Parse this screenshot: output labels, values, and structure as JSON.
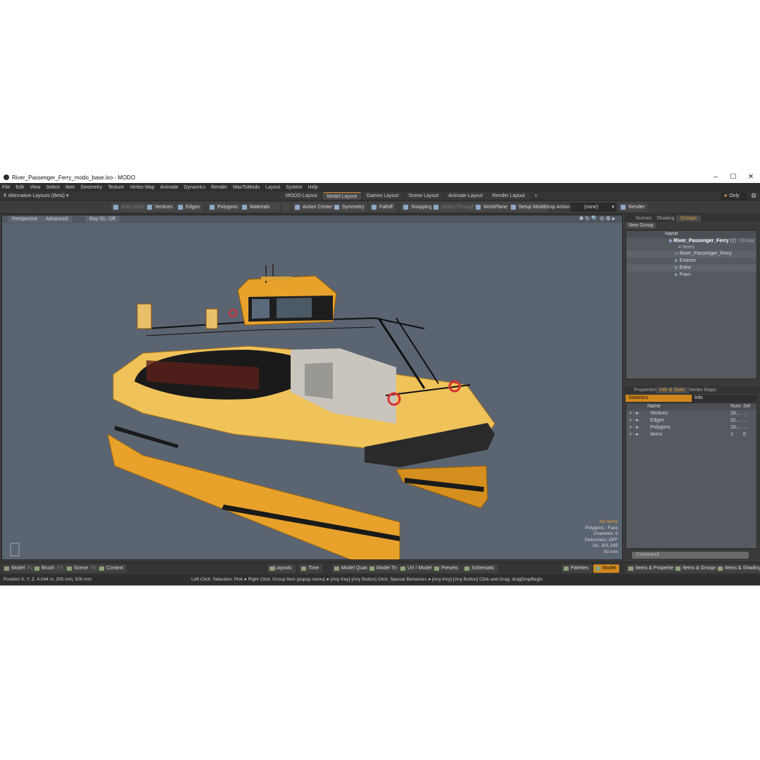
{
  "window": {
    "title": "River_Passenger_Ferry_modo_base.lxo - MODO",
    "minimize": "–",
    "maximize": "☐",
    "close": "✕"
  },
  "menu": [
    "File",
    "Edit",
    "View",
    "Select",
    "Item",
    "Geometry",
    "Texture",
    "Vertex Map",
    "Animate",
    "Dynamics",
    "Render",
    "MaxToModo",
    "Layout",
    "System",
    "Help"
  ],
  "layout_selector": "Alternative Layouts (Beta)",
  "layout_tabs": [
    "MODO Layout",
    "Model Layout",
    "Games Layout",
    "Scene Layout",
    "Animate Layout",
    "Render Layout"
  ],
  "layout_add": "+",
  "only_label": "Only",
  "toolbar": {
    "auto_select": "Auto Select",
    "vertices": "Vertices",
    "edges": "Edges",
    "polygons": "Polygons",
    "materials": "Materials",
    "action_center": "Action Center",
    "symmetry": "Symmetry",
    "falloff": "Falloff",
    "snapping": "Snapping",
    "select_through": "Select Through",
    "workplane": "WorkPlane",
    "setup_mode": "Setup Mode",
    "drop_action": "Drop Action",
    "drop_value": "(none)",
    "render": "Render"
  },
  "viewport": {
    "view": "Perspective",
    "mode": "Advanced",
    "raygl": "Ray GL: Off",
    "stats": [
      "No Items",
      "Polygons : Face",
      "Channels: 0",
      "Deformers: OFF",
      "GL: 301,345",
      "50 mm"
    ]
  },
  "groups_panel": {
    "tabs": [
      "Scenes",
      "Shading",
      "Groups"
    ],
    "new_group": "New Group",
    "name_header": "Name",
    "root": "River_Passenger_Ferry",
    "root_count": "(2)",
    "root_type": ": Group",
    "items_label": "4 Items",
    "children": [
      "River_Passenger_Ferry",
      "Exterior",
      "Extra",
      "Fram"
    ]
  },
  "info_panel": {
    "tabs": [
      "Properties",
      "Info & Stats",
      "Vertex Maps"
    ],
    "subtabs": [
      "Statistics",
      "Info"
    ],
    "headers": [
      "Name",
      "Num",
      "Sel"
    ],
    "rows": [
      {
        "name": "Vertices",
        "num": "16...",
        "sel": "..."
      },
      {
        "name": "Edges",
        "num": "31...",
        "sel": "..."
      },
      {
        "name": "Polygons",
        "num": "15...",
        "sel": "..."
      },
      {
        "name": "Items",
        "num": "1",
        "sel": "0"
      }
    ]
  },
  "command_placeholder": "Command",
  "bottom_bar": {
    "model": "Model",
    "model_key": "F2",
    "brush": "Brush",
    "brush_key": "F3",
    "scene": "Scene",
    "scene_key": "F4",
    "context": "Context",
    "layouts": "Layouts",
    "time": "Time",
    "model_quad": "Model Quad",
    "model_tri": "Model Tri",
    "uv_model": "UV / Model",
    "presets": "Presets",
    "schematic": "Schematic",
    "palettes": "Palettes",
    "model_active": "Model",
    "items_properties": "Items & Properties",
    "items_groups": "Items & Groups",
    "items_shading": "Items & Shading"
  },
  "status": {
    "position": "Position X, Y, Z:   4.044 m, 200 mm, 500 mm",
    "hint": "Left Click: Selection: Pick ● Right Click: Group Item (popup menu) ● [Any Key]-[Any Button] Click: Special Behaviors ● [Any Key]-[Any Button] Click and Drag: dragDropBegin"
  },
  "colors": {
    "accent": "#d2871d",
    "hull": "#e8a22c",
    "viewport_bg": "#5b6471"
  }
}
